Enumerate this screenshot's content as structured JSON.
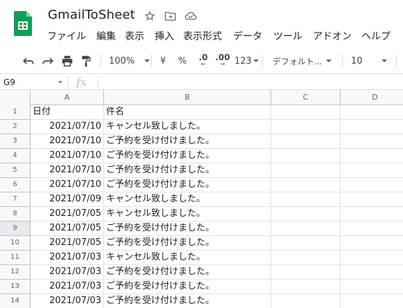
{
  "app": {
    "title": "GmailToSheet",
    "brand_color": "#0f9d58",
    "title_icons": [
      "star-icon",
      "move-to-folder-icon",
      "cloud-status-icon"
    ]
  },
  "menu": [
    "ファイル",
    "編集",
    "表示",
    "挿入",
    "表示形式",
    "データ",
    "ツール",
    "アドオン",
    "ヘルプ"
  ],
  "toolbar": {
    "zoom": "100%",
    "currency": "¥",
    "percent": "%",
    "decimal_decrease": ".0",
    "decimal_increase": ".00",
    "more_formats": "123",
    "font_family": "デフォルト...",
    "font_size": "10",
    "icons": [
      "undo-icon",
      "redo-icon",
      "print-icon",
      "paint-format-icon"
    ]
  },
  "formula_bar": {
    "name_box": "G9",
    "fx_label": "fx",
    "value": ""
  },
  "grid": {
    "columns": [
      "A",
      "B",
      "C",
      "D"
    ],
    "active_row": 9,
    "rows": [
      {
        "num": "1",
        "a": "日付",
        "b": "件名"
      },
      {
        "num": "2",
        "a": "2021/07/10",
        "b": "キャンセル致しました。"
      },
      {
        "num": "3",
        "a": "2021/07/10",
        "b": "ご予約を受け付けました。"
      },
      {
        "num": "4",
        "a": "2021/07/10",
        "b": "ご予約を受け付けました。"
      },
      {
        "num": "5",
        "a": "2021/07/10",
        "b": "ご予約を受け付けました。"
      },
      {
        "num": "6",
        "a": "2021/07/10",
        "b": "ご予約を受け付けました。"
      },
      {
        "num": "7",
        "a": "2021/07/09",
        "b": "キャンセル致しました。"
      },
      {
        "num": "8",
        "a": "2021/07/05",
        "b": "キャンセル致しました。"
      },
      {
        "num": "9",
        "a": "2021/07/05",
        "b": "ご予約を受け付けました。"
      },
      {
        "num": "10",
        "a": "2021/07/05",
        "b": "ご予約を受け付けました。"
      },
      {
        "num": "11",
        "a": "2021/07/03",
        "b": "キャンセル致しました。"
      },
      {
        "num": "12",
        "a": "2021/07/03",
        "b": "ご予約を受け付けました。"
      },
      {
        "num": "13",
        "a": "2021/07/03",
        "b": "ご予約を受け付けました。"
      },
      {
        "num": "14",
        "a": "2021/07/03",
        "b": "ご予約を受け付けました。"
      }
    ]
  }
}
